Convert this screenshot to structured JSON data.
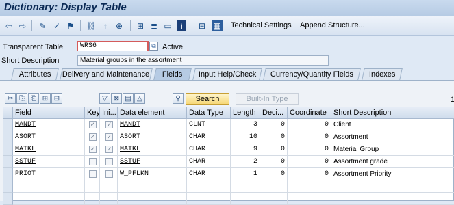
{
  "title": "Dictionary: Display Table",
  "toolbar": {
    "technical_settings": "Technical Settings",
    "append_structure": "Append Structure..."
  },
  "header": {
    "transparent_table_label": "Transparent Table",
    "table_name": "WRS6",
    "status": "Active",
    "short_description_label": "Short Description",
    "short_description": "Material groups in the assortment"
  },
  "tabs": [
    "Attributes",
    "Delivery and Maintenance",
    "Fields",
    "Input Help/Check",
    "Currency/Quantity Fields",
    "Indexes"
  ],
  "active_tab": "Fields",
  "field_toolbar": {
    "search": "Search",
    "built_in_type": "Built-In Type",
    "page_indicator": "1"
  },
  "columns": [
    "Field",
    "Key",
    "Ini...",
    "Data element",
    "Data Type",
    "Length",
    "Deci...",
    "Coordinate",
    "Short Description"
  ],
  "rows": [
    {
      "field": "MANDT",
      "key": true,
      "ini": true,
      "data_element": "MANDT",
      "data_type": "CLNT",
      "length": "3",
      "decimals": "0",
      "coordinate": "0",
      "short_description": "Client"
    },
    {
      "field": "ASORT",
      "key": true,
      "ini": true,
      "data_element": "ASORT",
      "data_type": "CHAR",
      "length": "10",
      "decimals": "0",
      "coordinate": "0",
      "short_description": "Assortment"
    },
    {
      "field": "MATKL",
      "key": true,
      "ini": true,
      "data_element": "MATKL",
      "data_type": "CHAR",
      "length": "9",
      "decimals": "0",
      "coordinate": "0",
      "short_description": "Material Group"
    },
    {
      "field": "SSTUF",
      "key": false,
      "ini": false,
      "data_element": "SSTUF",
      "data_type": "CHAR",
      "length": "2",
      "decimals": "0",
      "coordinate": "0",
      "short_description": "Assortment grade"
    },
    {
      "field": "PRIOT",
      "key": false,
      "ini": false,
      "data_element": "W_PFLKN",
      "data_type": "CHAR",
      "length": "1",
      "decimals": "0",
      "coordinate": "0",
      "short_description": "Assortment Priority"
    }
  ]
}
